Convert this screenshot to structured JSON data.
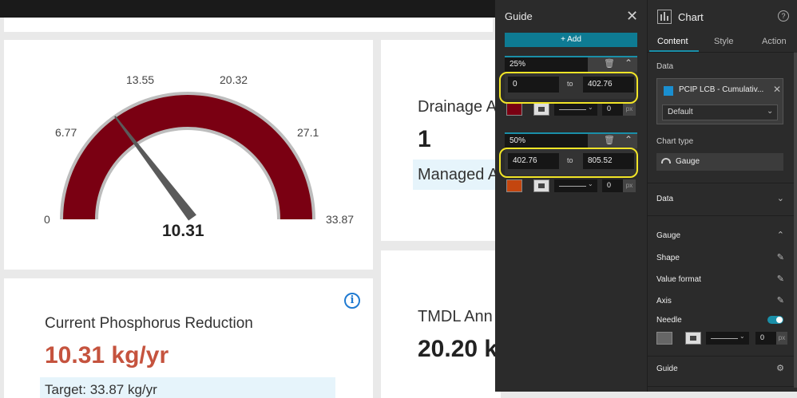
{
  "gauge_card": {
    "ticks": [
      "0",
      "6.77",
      "13.55",
      "20.32",
      "27.1",
      "33.87"
    ],
    "value": "10.31",
    "min": 0,
    "max": 33.87,
    "needle_value": 10.31,
    "arc_color": "#7a0012"
  },
  "drainage_card": {
    "title": "Drainage A",
    "value": "1",
    "managed_label": "Managed A"
  },
  "phosphorus_card": {
    "title": "Current Phosphorus Reduction",
    "value": "10.31 kg/yr",
    "target": "Target: 33.87 kg/yr",
    "info_icon": "i",
    "value_color": "#c5533e"
  },
  "tmdl_card": {
    "title": "TMDL Ann",
    "value": "20.20 k"
  },
  "guide_panel": {
    "title": "Guide",
    "close": "✕",
    "add_label": "+ Add",
    "items": [
      {
        "percent": "25%",
        "from": "0",
        "to_label": "to",
        "to": "402.76",
        "color": "#7a0012",
        "width": "0",
        "unit": "px"
      },
      {
        "percent": "50%",
        "from": "402.76",
        "to_label": "to",
        "to": "805.52",
        "color": "#c4460f",
        "width": "0",
        "unit": "px"
      }
    ]
  },
  "chart_panel": {
    "title": "Chart",
    "help": "?",
    "tabs": [
      "Content",
      "Style",
      "Action"
    ],
    "data_label": "Data",
    "datasource_name": "PCIP LCB - Cumulativ...",
    "datasource_close": "✕",
    "datasource_select": "Default",
    "chart_type_label": "Chart type",
    "chart_type": "Gauge",
    "sections": {
      "data": "Data",
      "gauge": "Gauge",
      "shape": "Shape",
      "value_format": "Value format",
      "axis": "Axis",
      "needle": "Needle",
      "guide": "Guide"
    },
    "needle_width": "0",
    "needle_unit": "px"
  }
}
